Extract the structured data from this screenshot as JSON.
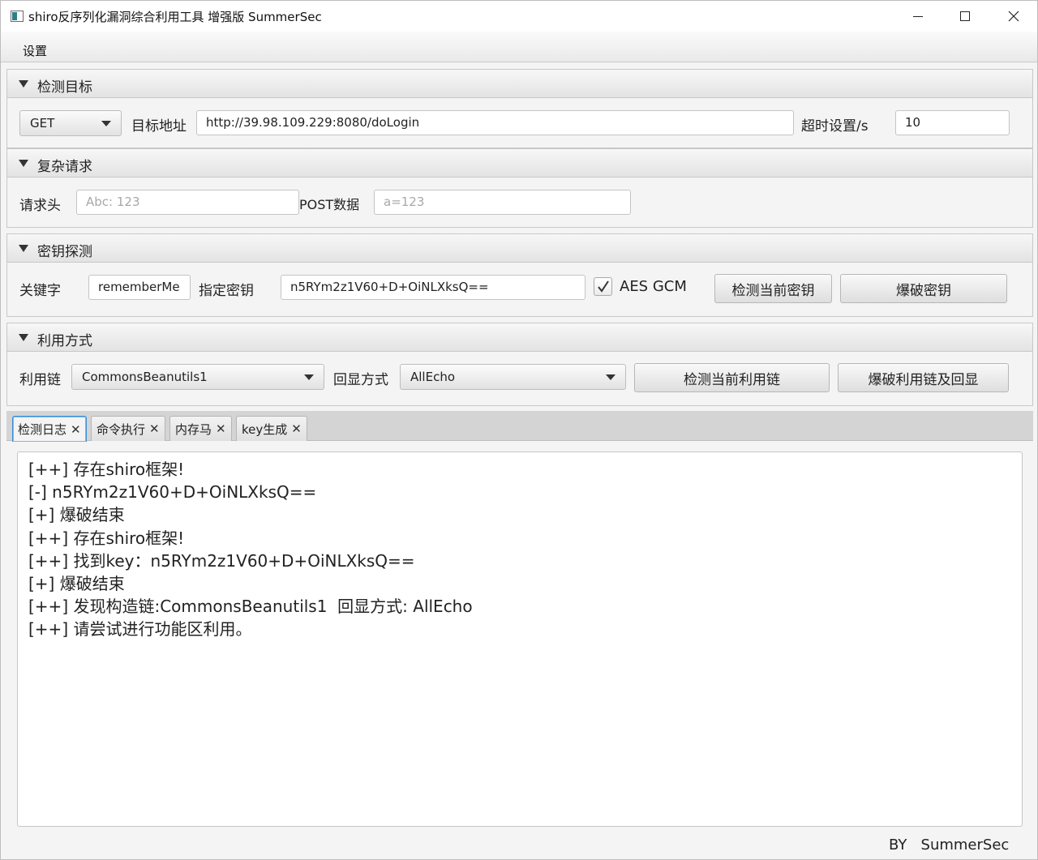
{
  "window": {
    "title": "shiro反序列化漏洞综合利用工具 增强版 SummerSec"
  },
  "menu": {
    "items": [
      "设置"
    ]
  },
  "target": {
    "title": "检测目标",
    "method": "GET",
    "url_label": "目标地址",
    "url": "http://39.98.109.229:8080/doLogin",
    "timeout_label": "超时设置/s",
    "timeout": "10"
  },
  "complex": {
    "title": "复杂请求",
    "headers_label": "请求头",
    "headers_placeholder": "Abc: 123",
    "post_label": "POST数据",
    "post_placeholder": "a=123"
  },
  "key": {
    "title": "密钥探测",
    "keyword_label": "关键字",
    "keyword": "rememberMe",
    "key_label": "指定密钥",
    "key": "n5RYm2z1V60+D+OiNLXksQ==",
    "aes_gcm_label": "AES GCM",
    "aes_gcm_checked": true,
    "check_button": "检测当前密钥",
    "brute_button": "爆破密钥"
  },
  "exploit": {
    "title": "利用方式",
    "chain_label": "利用链",
    "chain": "CommonsBeanutils1",
    "echo_label": "回显方式",
    "echo": "AllEcho",
    "check_button": "检测当前利用链",
    "brute_button": "爆破利用链及回显"
  },
  "tabs": [
    {
      "label": "检测日志",
      "active": true
    },
    {
      "label": "命令执行",
      "active": false
    },
    {
      "label": "内存马",
      "active": false
    },
    {
      "label": "key生成",
      "active": false
    }
  ],
  "log": [
    "[++] 存在shiro框架!",
    "[-] n5RYm2z1V60+D+OiNLXksQ==",
    "[+] 爆破结束",
    "[++] 存在shiro框架!",
    "[++] 找到key：n5RYm2z1V60+D+OiNLXksQ==",
    "[+] 爆破结束",
    "[++] 发现构造链:CommonsBeanutils1  回显方式: AllEcho",
    "[++] 请尝试进行功能区利用。"
  ],
  "footer": "BY   SummerSec"
}
